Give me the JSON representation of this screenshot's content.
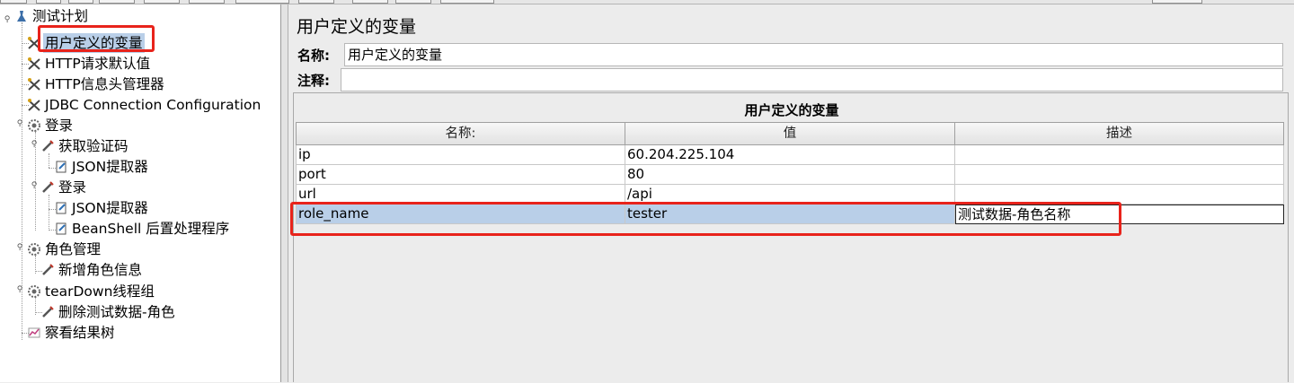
{
  "tree": {
    "items": [
      {
        "label": "测试计划",
        "icon": "test-plan-icon"
      },
      {
        "label": "用户定义的变量",
        "icon": "config-element-icon"
      },
      {
        "label": "HTTP请求默认值",
        "icon": "config-element-icon"
      },
      {
        "label": "HTTP信息头管理器",
        "icon": "config-element-icon"
      },
      {
        "label": "JDBC Connection Configuration",
        "icon": "config-element-icon"
      },
      {
        "label": "登录",
        "icon": "thread-group-icon"
      },
      {
        "label": "获取验证码",
        "icon": "sampler-icon"
      },
      {
        "label": "JSON提取器",
        "icon": "post-processor-icon"
      },
      {
        "label": "登录",
        "icon": "sampler-icon"
      },
      {
        "label": "JSON提取器",
        "icon": "post-processor-icon"
      },
      {
        "label": "BeanShell 后置处理程序",
        "icon": "post-processor-icon"
      },
      {
        "label": "角色管理",
        "icon": "thread-group-icon"
      },
      {
        "label": "新增角色信息",
        "icon": "sampler-icon"
      },
      {
        "label": "tearDown线程组",
        "icon": "thread-group-icon"
      },
      {
        "label": "删除测试数据-角色",
        "icon": "sampler-icon"
      },
      {
        "label": "察看结果树",
        "icon": "listener-icon"
      }
    ]
  },
  "panel": {
    "title": "用户定义的变量",
    "name_label": "名称:",
    "name_value": "用户定义的变量",
    "comment_label": "注释:",
    "comment_value": "",
    "group_title": "用户定义的变量"
  },
  "table": {
    "headers": [
      "名称:",
      "值",
      "描述"
    ],
    "rows": [
      [
        "ip",
        "60.204.225.104",
        ""
      ],
      [
        "port",
        "80",
        ""
      ],
      [
        "url",
        "/api",
        ""
      ],
      [
        "role_name",
        "tester",
        "测试数据-角色名称"
      ]
    ]
  },
  "colors": {
    "selection": "#b9cfe8",
    "highlight": "#e8231b"
  }
}
